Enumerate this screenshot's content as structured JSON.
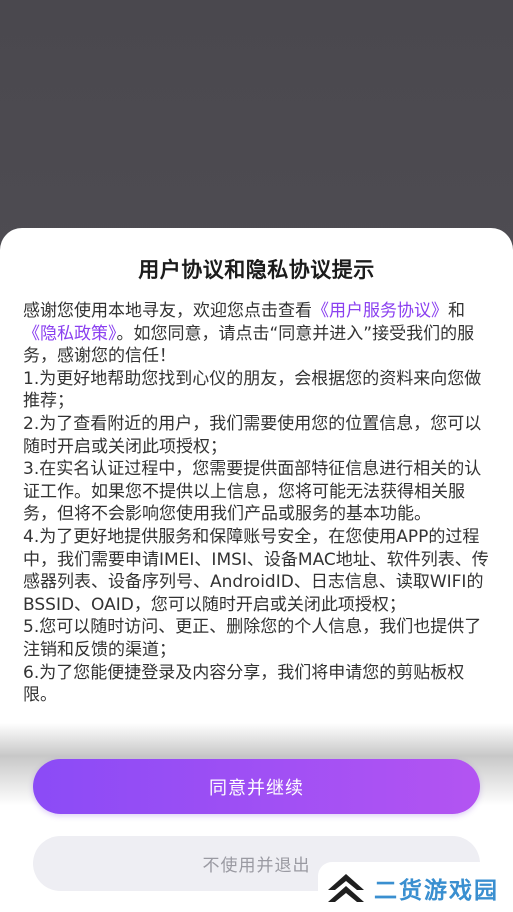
{
  "dialog": {
    "title": "用户协议和隐私协议提示",
    "intro": {
      "before_links": "感谢您使用本地寻友，欢迎您点击查看",
      "link_service": "《用户服务协议》",
      "and": "和",
      "link_privacy": "《隐私政策》",
      "after_links": "。如您同意，请点击“同意并进入”接受我们的服务，感谢您的信任！"
    },
    "items": [
      "1.为更好地帮助您找到心仪的朋友，会根据您的资料来向您做推荐；",
      "2.为了查看附近的用户，我们需要使用您的位置信息，您可以随时开启或关闭此项授权；",
      "3.在实名认证过程中，您需要提供面部特征信息进行相关的认证工作。如果您不提供以上信息，您将可能无法获得相关服务，但将不会影响您使用我们产品或服务的基本功能。",
      "4.为了更好地提供服务和保障账号安全，在您使用APP的过程中，我们需要申请IMEI、IMSI、设备MAC地址、软件列表、传感器列表、设备序列号、AndroidID、日志信息、读取WIFI的BSSID、OAID，您可以随时开启或关闭此项授权；",
      "5.您可以随时访问、更正、删除您的个人信息，我们也提供了注销和反馈的渠道；",
      "6.为了您能便捷登录及内容分享，我们将申请您的剪贴板权限。"
    ],
    "agree_label": "同意并继续",
    "reject_label": "不使用并退出"
  },
  "watermark": {
    "text": "二货游戏园",
    "logo_icon": "double-chevron-up-logo"
  },
  "colors": {
    "accent": "#8a3ff0",
    "button_gradient_start": "#8b4bf6",
    "button_gradient_end": "#b354f2",
    "watermark_blue": "#3a8fd0"
  }
}
